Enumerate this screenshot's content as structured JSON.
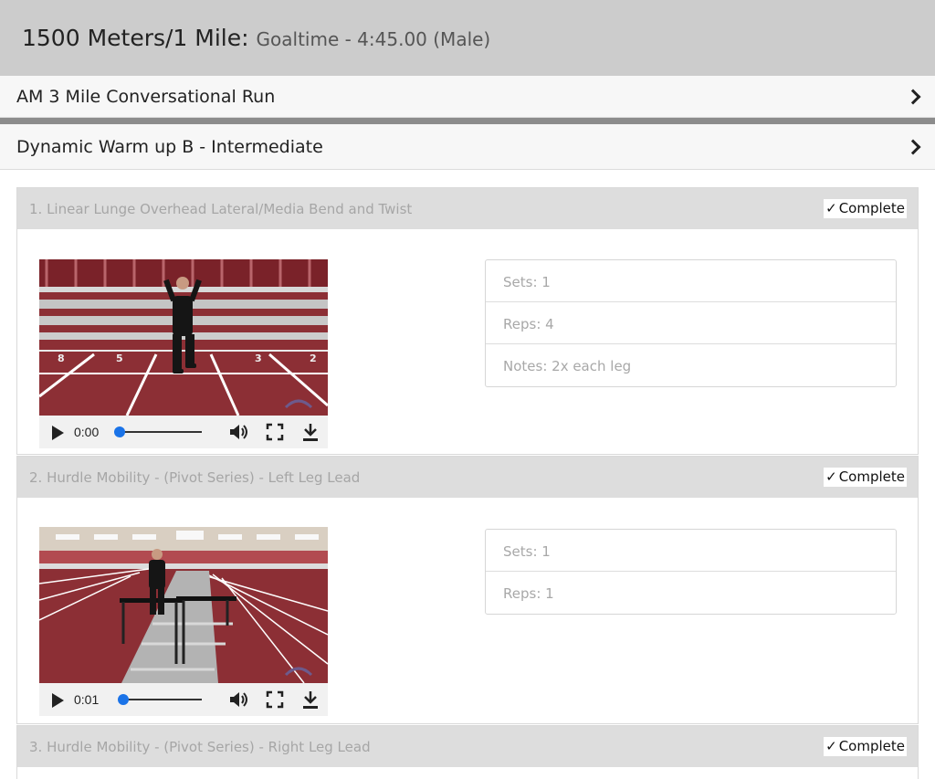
{
  "header": {
    "title": "1500 Meters/1 Mile:",
    "subtitle": "Goaltime - 4:45.00 (Male)"
  },
  "sections": [
    {
      "label": "AM 3 Mile Conversational Run",
      "icon": "chevron-right-icon"
    },
    {
      "label": "Dynamic Warm up B - Intermediate",
      "icon": "chevron-right-icon"
    }
  ],
  "exercises": [
    {
      "title": "1. Linear Lunge Overhead Lateral/Media Bend and Twist",
      "complete_label": "Complete",
      "video": {
        "time": "0:00",
        "progress": 0
      },
      "details": {
        "sets": "Sets: 1",
        "reps": "Reps: 4",
        "notes": "Notes: 2x each leg"
      }
    },
    {
      "title": "2. Hurdle Mobility - (Pivot Series) - Left Leg Lead",
      "complete_label": "Complete",
      "video": {
        "time": "0:01",
        "progress": 0.04
      },
      "details": {
        "sets": "Sets: 1",
        "reps": "Reps: 1"
      }
    },
    {
      "title": "3. Hurdle Mobility - (Pivot Series) - Right Leg Lead",
      "complete_label": "Complete"
    }
  ],
  "colors": {
    "header_bg": "#cccccc",
    "card_header_bg": "#dddddd",
    "accent_blue": "#1a73e8",
    "track_red": "#8c2f35"
  }
}
